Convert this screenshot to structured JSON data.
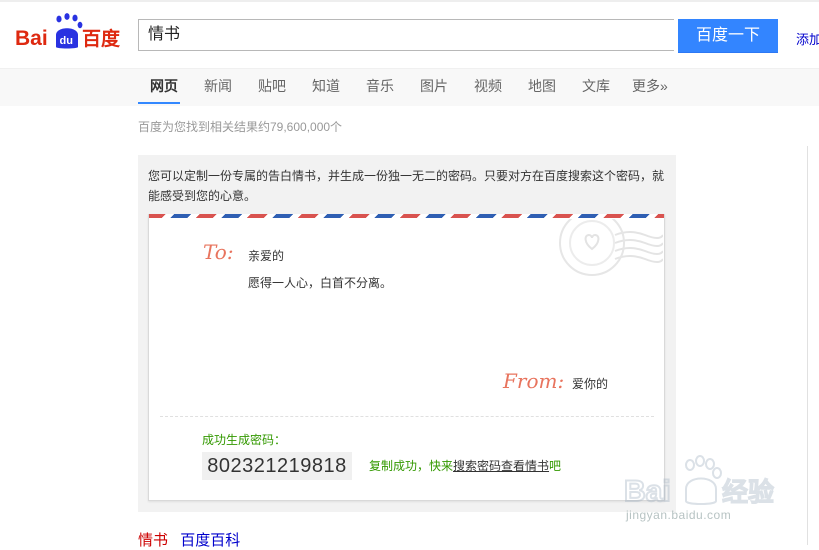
{
  "logo": {
    "text_bai": "Bai",
    "text_du": "du",
    "text_cn": "百度"
  },
  "search": {
    "query": "情书",
    "button_label": "百度一下",
    "add_label": "添加"
  },
  "tabs": [
    {
      "label": "网页",
      "active": true
    },
    {
      "label": "新闻"
    },
    {
      "label": "贴吧"
    },
    {
      "label": "知道"
    },
    {
      "label": "音乐"
    },
    {
      "label": "图片"
    },
    {
      "label": "视频"
    },
    {
      "label": "地图"
    },
    {
      "label": "文库"
    },
    {
      "label": "更多»"
    }
  ],
  "result_count": "百度为您找到相关结果约79,600,000个",
  "card": {
    "intro": "您可以定制一份专属的告白情书，并生成一份独一无二的密码。只要对方在百度搜索这个密码，就能感受到您的心意。",
    "to_label": "To:",
    "to_name": "亲爱的",
    "body": "愿得一人心，白首不分离。",
    "from_label": "From:",
    "from_name": "爱你的",
    "code_label": "成功生成密码：",
    "code": "802321219818",
    "copy_prefix": "复制成功，快来",
    "copy_link": "搜索密码查看情书",
    "copy_suffix": "吧"
  },
  "bottom_links": {
    "first": "情书",
    "second": "百度百科"
  },
  "watermark": {
    "text": "jingyan.baidu.com"
  },
  "colors": {
    "accent": "#3385ff",
    "logo_red": "#de2910",
    "logo_blue": "#2932e1",
    "success_green": "#339900",
    "script_orange": "#e8745e"
  }
}
